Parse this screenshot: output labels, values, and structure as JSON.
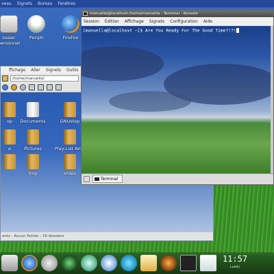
{
  "topbar": {
    "items": [
      "veau",
      "Signets",
      "Bureau",
      "Fenêtres"
    ]
  },
  "desktop": {
    "icons": [
      {
        "label": "ossier\npersonnel",
        "color": "#dcdcdc"
      },
      {
        "label": "Periph",
        "color": "#f0f0f0"
      },
      {
        "label": "FireFox",
        "color": "#3a7fd0"
      }
    ]
  },
  "file_manager": {
    "menu": [
      "ffichage",
      "Aller",
      "Signets",
      "Outils",
      "Co"
    ],
    "address": "/home/manuella/",
    "items": [
      {
        "label": "op",
        "type": "folder"
      },
      {
        "label": "Documents",
        "type": "doc"
      },
      {
        "label": "GNUstep",
        "type": "folder"
      },
      {
        "label": "e",
        "type": "folder"
      },
      {
        "label": "Pictures",
        "type": "folder"
      },
      {
        "label": "Play-List Ama",
        "type": "folder"
      },
      {
        "label": "",
        "type": "folder"
      },
      {
        "label": "tmp",
        "type": "folder"
      },
      {
        "label": "Vidéo",
        "type": "folder"
      }
    ],
    "status": "ents - Aucun fichier - 16 dossiers"
  },
  "terminal": {
    "title": "manuella@localhost:/home/manuella - Terminal - Konsole",
    "menu": [
      "Session",
      "Édition",
      "Affichage",
      "Signets",
      "Configuration",
      "Aide"
    ],
    "prompt_line": "[manuella@localhost ~]$ Are You Ready For The Good Time?!?!",
    "tab_label": "Terminal"
  },
  "taskbar": {
    "clock_time": "11:57",
    "clock_day": "Lundi"
  }
}
